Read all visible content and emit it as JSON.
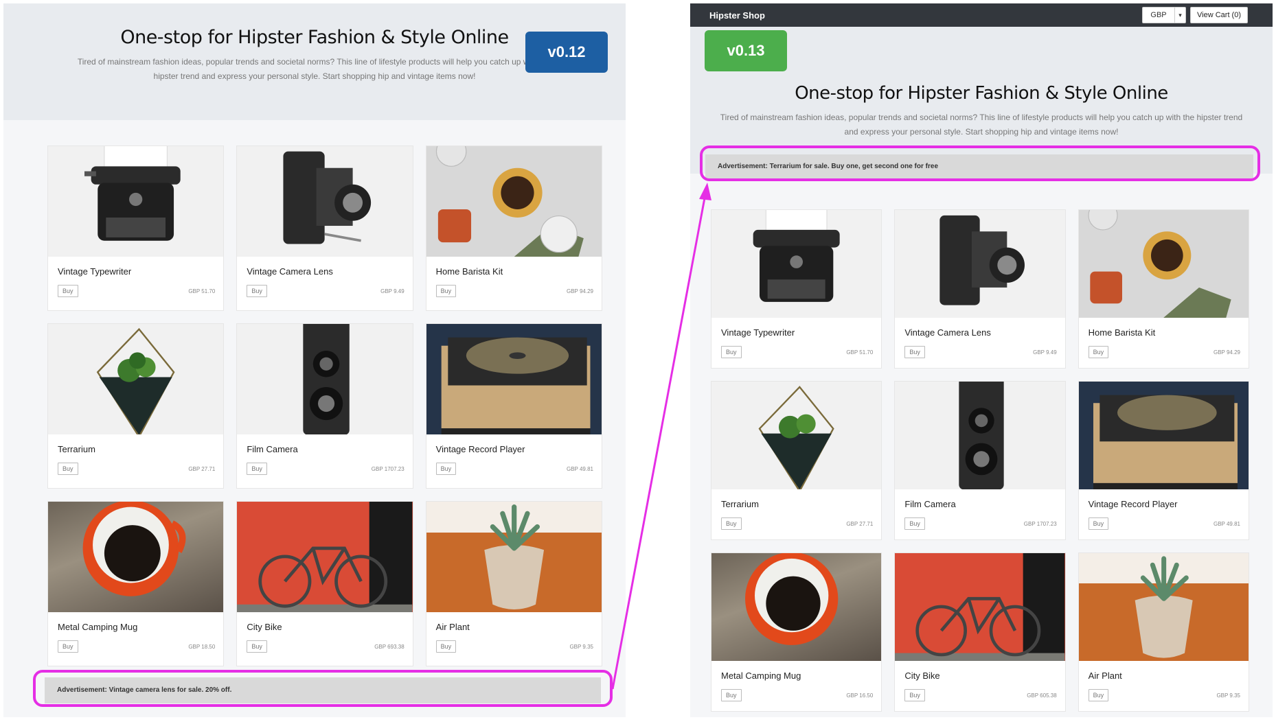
{
  "left": {
    "version_badge": "v0.12",
    "hero": {
      "title": "One-stop for Hipster Fashion & Style Online",
      "tagline": "Tired of mainstream fashion ideas, popular trends and societal norms? This line of lifestyle products will help you catch up with the hipster trend and express your personal style. Start shopping hip and vintage items now!"
    },
    "products": [
      {
        "name": "Vintage Typewriter",
        "buy": "Buy",
        "price": "GBP 51.70",
        "icon": "typewriter"
      },
      {
        "name": "Vintage Camera Lens",
        "buy": "Buy",
        "price": "GBP 9.49",
        "icon": "folding-camera"
      },
      {
        "name": "Home Barista Kit",
        "buy": "Buy",
        "price": "GBP 94.29",
        "icon": "coffee"
      },
      {
        "name": "Terrarium",
        "buy": "Buy",
        "price": "GBP 27.71",
        "icon": "terrarium"
      },
      {
        "name": "Film Camera",
        "buy": "Buy",
        "price": "GBP 1707.23",
        "icon": "tlr-camera"
      },
      {
        "name": "Vintage Record Player",
        "buy": "Buy",
        "price": "GBP 49.81",
        "icon": "record-player"
      },
      {
        "name": "Metal Camping Mug",
        "buy": "Buy",
        "price": "GBP 18.50",
        "icon": "mug"
      },
      {
        "name": "City Bike",
        "buy": "Buy",
        "price": "GBP 693.38",
        "icon": "bike"
      },
      {
        "name": "Air Plant",
        "buy": "Buy",
        "price": "GBP 9.35",
        "icon": "plant"
      }
    ],
    "advertisement": "Advertisement: Vintage camera lens for sale. 20% off."
  },
  "right": {
    "navbar": {
      "brand": "Hipster Shop",
      "currency": "GBP",
      "caret": "▾",
      "cart": "View Cart (0)"
    },
    "version_badge": "v0.13",
    "hero": {
      "title": "One-stop for Hipster Fashion & Style Online",
      "tagline": "Tired of mainstream fashion ideas, popular trends and societal norms? This line of lifestyle products will help you catch up with the hipster trend and express your personal style. Start shopping hip and vintage items now!"
    },
    "advertisement": "Advertisement: Terrarium for sale. Buy one, get second one for free",
    "products": [
      {
        "name": "Vintage Typewriter",
        "buy": "Buy",
        "price": "GBP 51.70",
        "icon": "typewriter"
      },
      {
        "name": "Vintage Camera Lens",
        "buy": "Buy",
        "price": "GBP 9.49",
        "icon": "folding-camera"
      },
      {
        "name": "Home Barista Kit",
        "buy": "Buy",
        "price": "GBP 94.29",
        "icon": "coffee"
      },
      {
        "name": "Terrarium",
        "buy": "Buy",
        "price": "GBP 27.71",
        "icon": "terrarium"
      },
      {
        "name": "Film Camera",
        "buy": "Buy",
        "price": "GBP 1707.23",
        "icon": "tlr-camera"
      },
      {
        "name": "Vintage Record Player",
        "buy": "Buy",
        "price": "GBP 49.81",
        "icon": "record-player"
      },
      {
        "name": "Metal Camping Mug",
        "buy": "Buy",
        "price": "GBP 16.50",
        "icon": "mug"
      },
      {
        "name": "City Bike",
        "buy": "Buy",
        "price": "GBP 605.38",
        "icon": "bike"
      },
      {
        "name": "Air Plant",
        "buy": "Buy",
        "price": "GBP 9.35",
        "icon": "plant"
      }
    ]
  },
  "colors": {
    "highlight": "#e52ee5",
    "badge_old": "#1d5fa3",
    "badge_new": "#4cae4c",
    "navbar": "#33373d"
  }
}
